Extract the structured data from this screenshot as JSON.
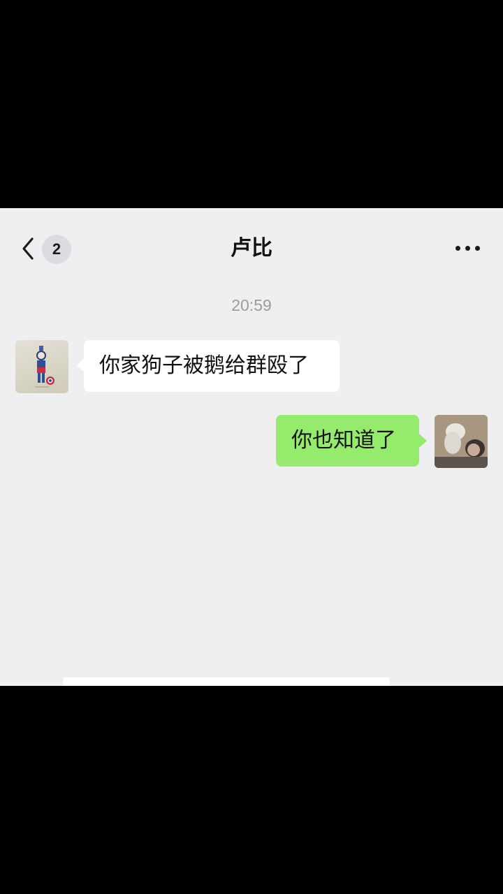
{
  "header": {
    "back_badge_count": "2",
    "title": "卢比"
  },
  "messages": [
    {
      "sender": "contact",
      "text": "你家狗子被鹅给群殴了"
    },
    {
      "sender": "me",
      "text": "你也知道了"
    }
  ],
  "timestamp": "20:59",
  "icons": {
    "back": "chevron-left-icon",
    "more": "more-dots-icon"
  },
  "colors": {
    "background": "#efeef1",
    "sent_bubble": "#95eb6c",
    "received_bubble": "#ffffff",
    "timestamp_text": "#9c9c9f"
  }
}
